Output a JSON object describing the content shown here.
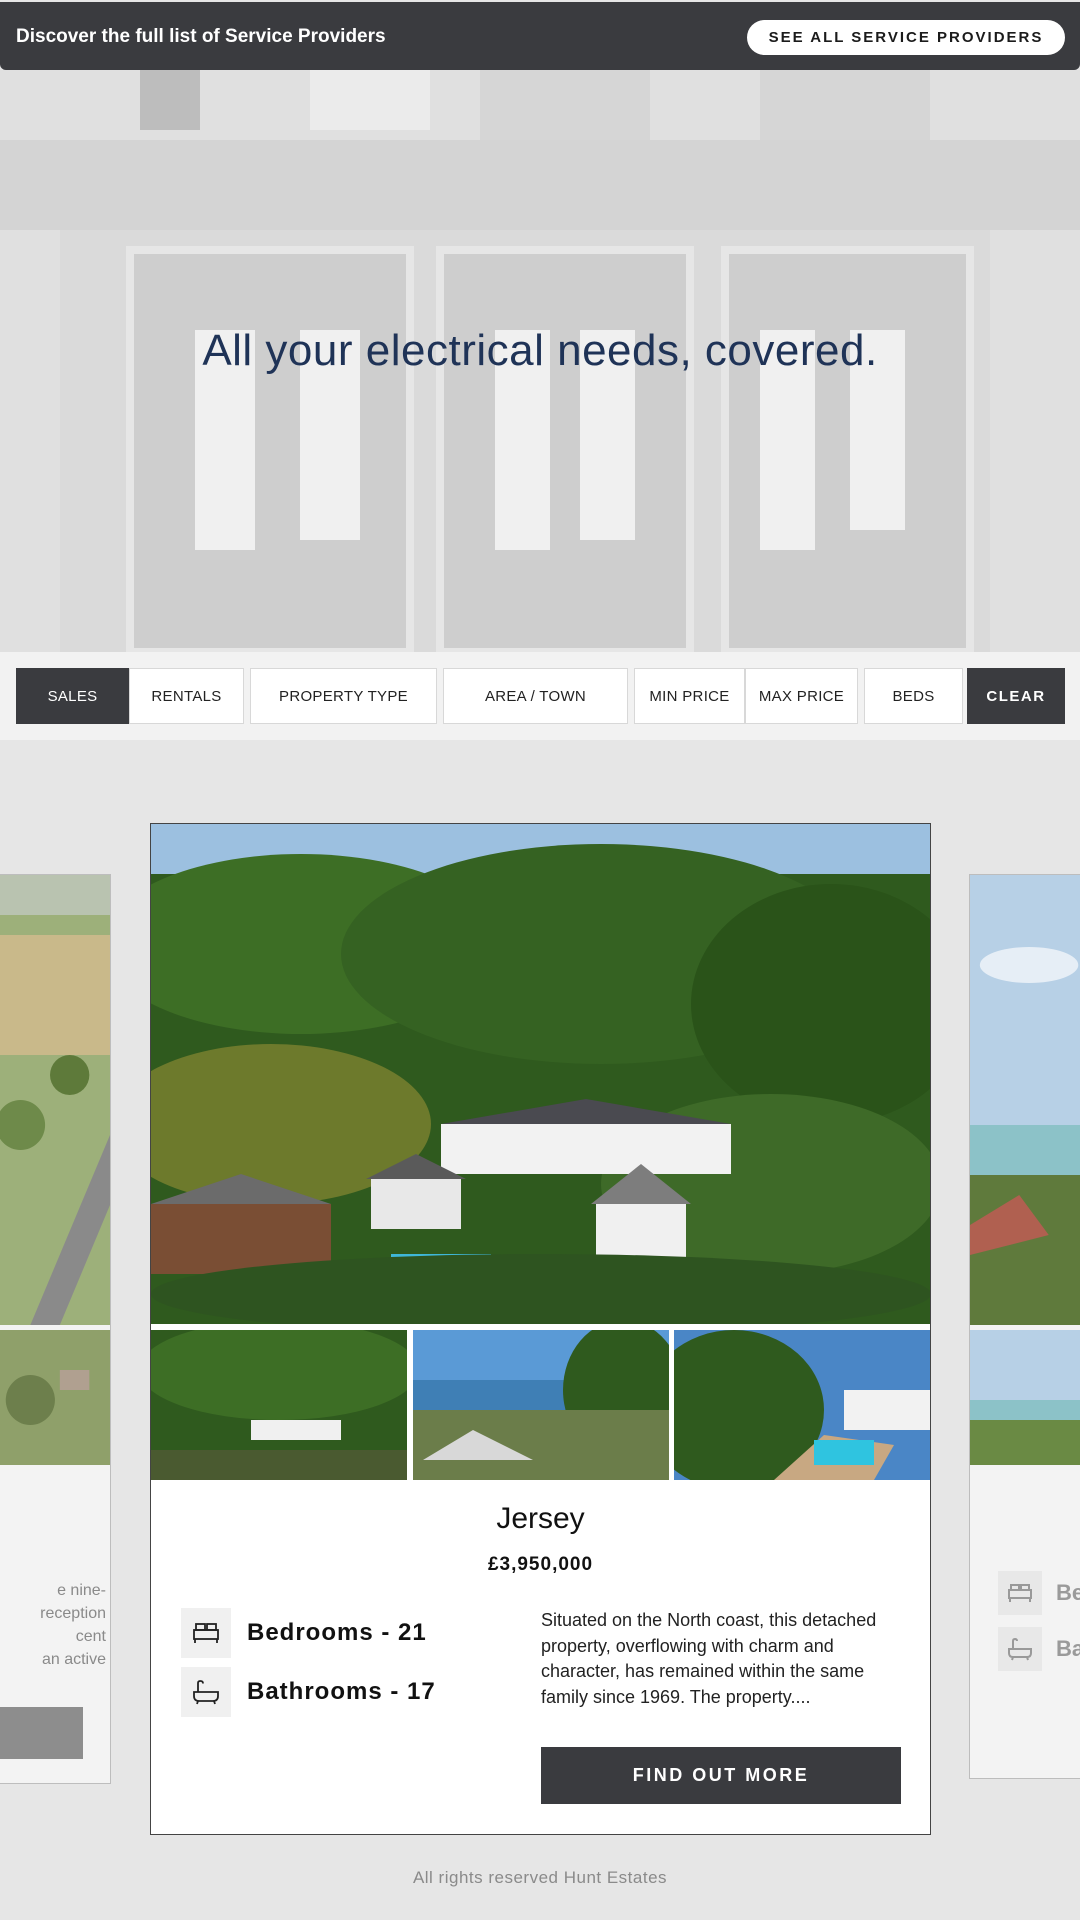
{
  "topbar": {
    "text": "Discover the full list of Service Providers",
    "button_label": "SEE ALL SERVICE PROVIDERS"
  },
  "hero": {
    "title": "All your electrical needs, covered."
  },
  "filters": {
    "sales": "SALES",
    "rentals": "RENTALS",
    "property_type": "PROPERTY TYPE",
    "area_town": "AREA / TOWN",
    "min_price": "MIN PRICE",
    "max_price": "MAX PRICE",
    "beds": "BEDS",
    "clear": "CLEAR"
  },
  "left_card": {
    "text_lines": [
      "e nine-",
      "reception",
      "cent",
      "an active"
    ]
  },
  "right_card": {
    "bedrooms_partial": "Be",
    "bathrooms_partial": "Ba"
  },
  "listing": {
    "title": "Jersey",
    "price": "£3,950,000",
    "bedrooms": "Bedrooms - 21",
    "bathrooms": "Bathrooms - 17",
    "description": "Situated on the North coast, this detached property, overflowing with charm and character, has remained within the same family since 1969. The property....",
    "cta": "FIND OUT MORE"
  },
  "footer": {
    "text": "All rights reserved Hunt Estates"
  },
  "colors": {
    "dark": "#3a3b3f",
    "hero_title": "#1f3357",
    "page_bg": "#e6e6e6"
  }
}
